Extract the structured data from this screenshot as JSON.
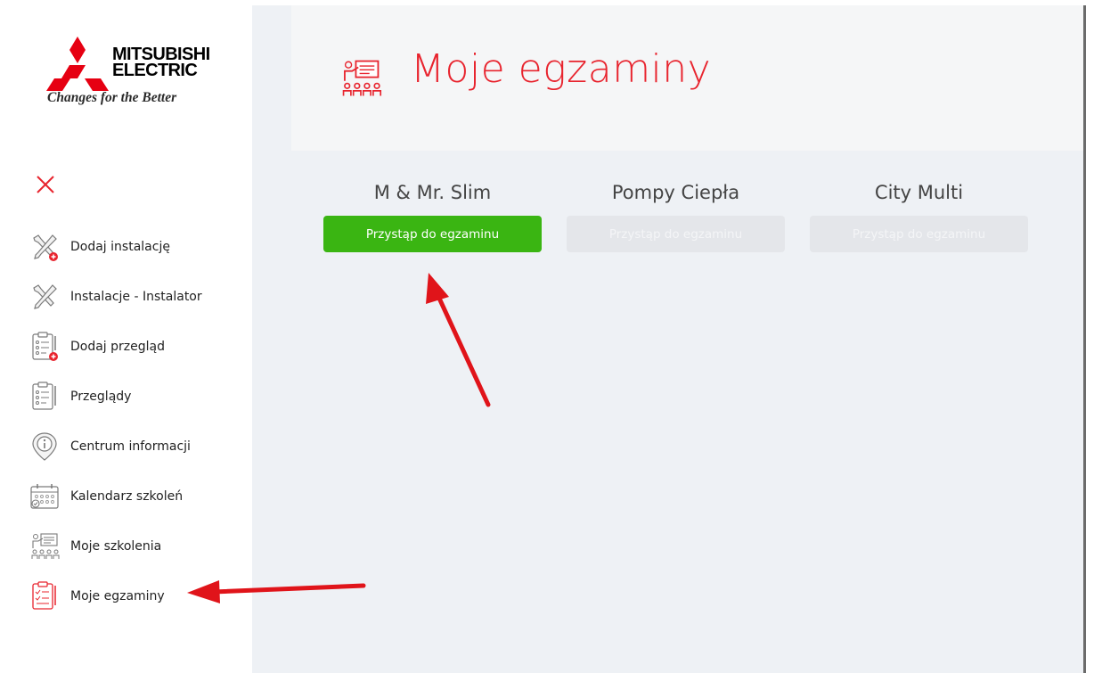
{
  "brand": {
    "name_line1": "MITSUBISHI",
    "name_line2": "ELECTRIC",
    "tagline": "Changes for the Better",
    "color": "#e60012"
  },
  "sidebar": {
    "close_icon": "close-icon",
    "items": [
      {
        "label": "Dodaj instalację",
        "icon": "tools-add-icon"
      },
      {
        "label": "Instalacje - Instalator",
        "icon": "tools-icon"
      },
      {
        "label": "Dodaj przegląd",
        "icon": "checklist-add-icon"
      },
      {
        "label": "Przeglądy",
        "icon": "checklist-icon"
      },
      {
        "label": "Centrum informacji",
        "icon": "info-pin-icon"
      },
      {
        "label": "Kalendarz szkoleń",
        "icon": "calendar-icon"
      },
      {
        "label": "Moje szkolenia",
        "icon": "training-icon"
      },
      {
        "label": "Moje egzaminy",
        "icon": "exam-icon"
      }
    ]
  },
  "header": {
    "title": "Moje egzaminy",
    "icon": "training-icon",
    "accent": "#e8242e"
  },
  "exams": [
    {
      "title": "M & Mr. Slim",
      "button_label": "Przystąp do egzaminu",
      "enabled": true
    },
    {
      "title": "Pompy Ciepła",
      "button_label": "Przystąp do egzaminu",
      "enabled": false
    },
    {
      "title": "City Multi",
      "button_label": "Przystąp do egzaminu",
      "enabled": false
    }
  ],
  "colors": {
    "active_button": "#3ab512",
    "disabled_button": "#e4e6ea",
    "annotation_arrow": "#e0141a"
  }
}
